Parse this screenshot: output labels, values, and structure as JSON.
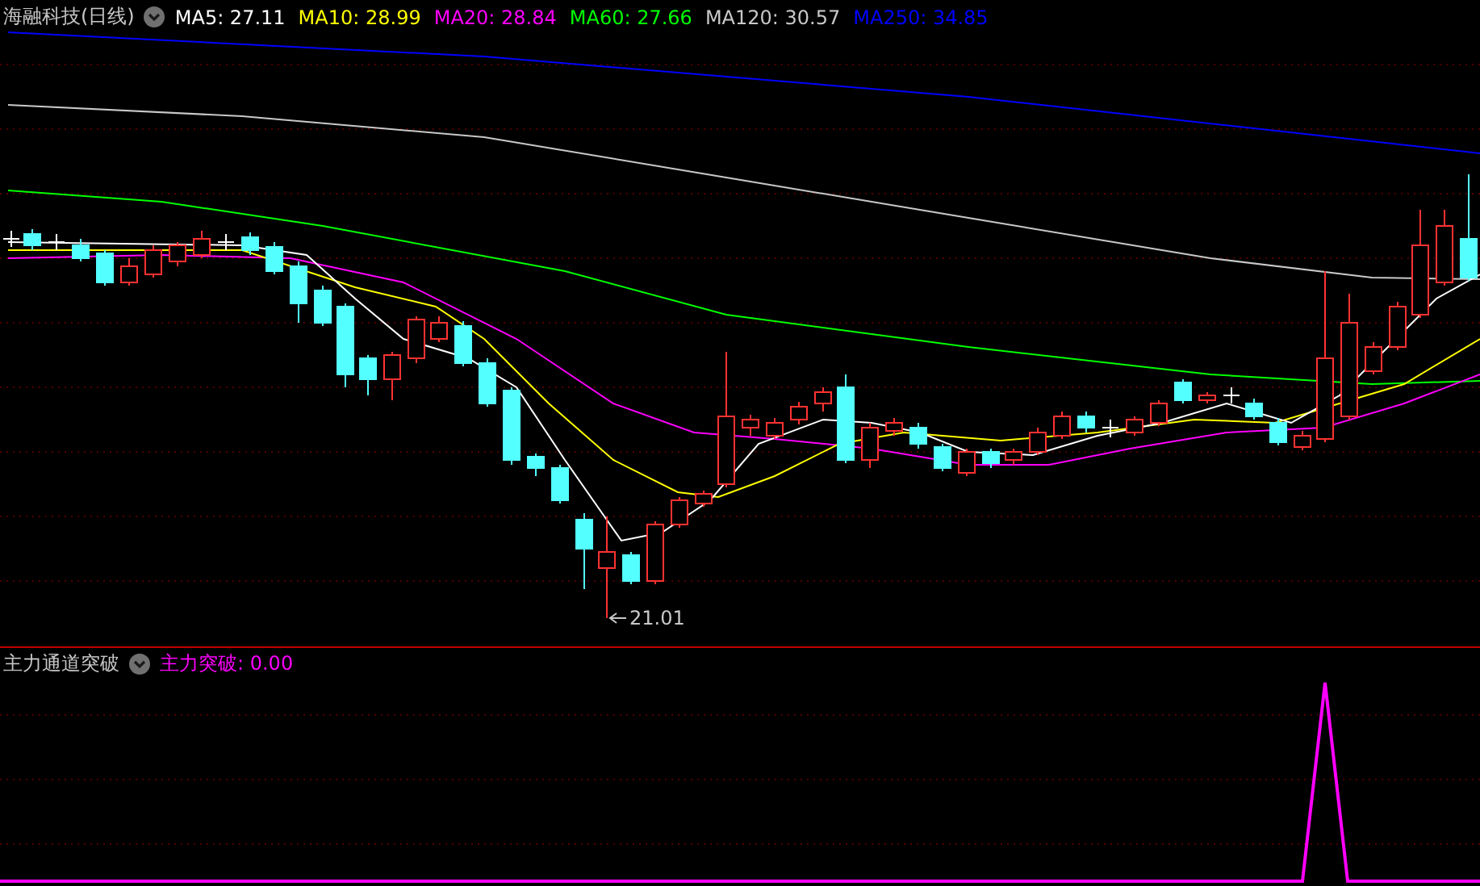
{
  "main_panel": {
    "title": "海融科技(日线)",
    "indicators": [
      {
        "label": "MA5: 27.11",
        "color": "#ffffff"
      },
      {
        "label": "MA10: 28.99",
        "color": "#ffff00"
      },
      {
        "label": "MA20: 28.84",
        "color": "#ff00ff"
      },
      {
        "label": "MA60: 27.66",
        "color": "#00ff00"
      },
      {
        "label": "MA120: 30.57",
        "color": "#c8c8c8"
      },
      {
        "label": "MA250: 34.85",
        "color": "#0000ff"
      }
    ],
    "low_label": "21.01"
  },
  "sub_panel": {
    "title": "主力通道突破",
    "indicators": [
      {
        "label": "主力突破: 0.00",
        "color": "#ff00ff"
      }
    ]
  }
}
